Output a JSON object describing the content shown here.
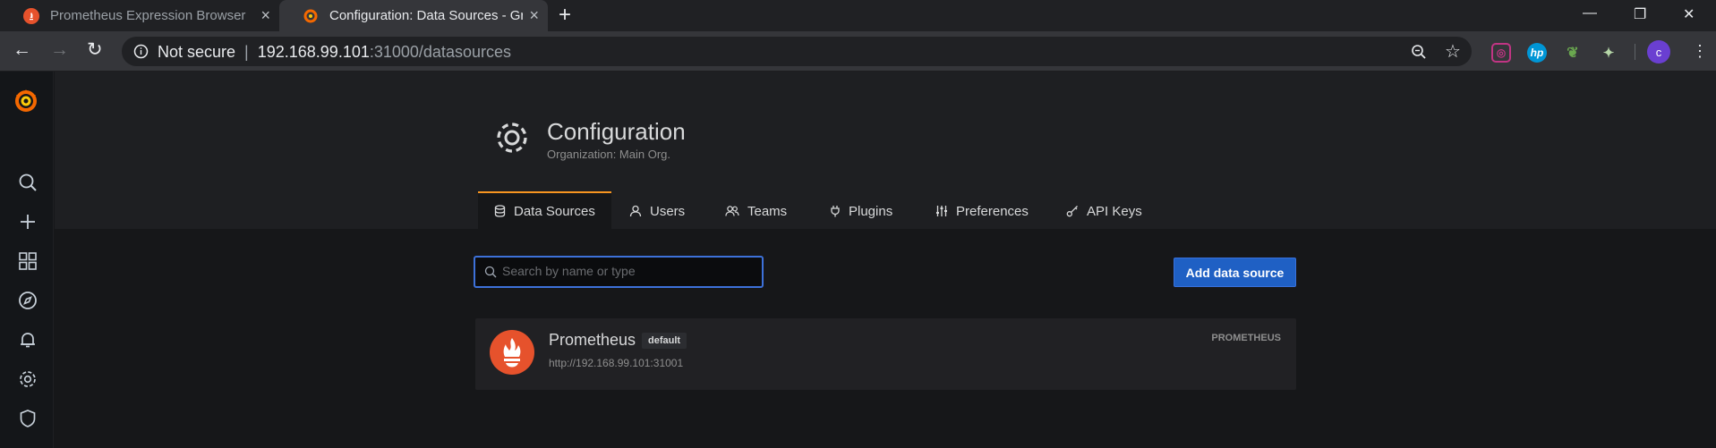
{
  "browser": {
    "tabs": [
      {
        "title": "Prometheus Expression Browser",
        "active": false
      },
      {
        "title": "Configuration: Data Sources - Grafana",
        "active": true
      }
    ],
    "new_tab": "+",
    "security_label": "Not secure",
    "url_host": "192.168.99.101",
    "url_rest": ":31000/datasources",
    "profile_initial": "c",
    "extensions": [
      "instagram-icon",
      "hp-icon",
      "leaf-icon",
      "bug-icon"
    ]
  },
  "sidebar": {
    "items": [
      "grafana-logo",
      "search-icon",
      "plus-icon",
      "dashboards-icon",
      "explore-icon",
      "alerting-icon",
      "configuration-icon",
      "shield-icon"
    ]
  },
  "page": {
    "title": "Configuration",
    "subtitle": "Organization: Main Org.",
    "tabs": [
      {
        "label": "Data Sources",
        "icon": "database-icon",
        "active": true
      },
      {
        "label": "Users",
        "icon": "user-icon",
        "active": false
      },
      {
        "label": "Teams",
        "icon": "users-icon",
        "active": false
      },
      {
        "label": "Plugins",
        "icon": "plug-icon",
        "active": false
      },
      {
        "label": "Preferences",
        "icon": "sliders-icon",
        "active": false
      },
      {
        "label": "API Keys",
        "icon": "key-icon",
        "active": false
      }
    ]
  },
  "search": {
    "placeholder": "Search by name or type",
    "value": ""
  },
  "add_button": "Add data source",
  "datasources": [
    {
      "name": "Prometheus",
      "badge": "default",
      "url": "http://192.168.99.101:31001",
      "type": "PROMETHEUS"
    }
  ],
  "colors": {
    "accent": "#f79520",
    "primary": "#1f60c4",
    "prometheus": "#e6522c",
    "background": "#161719"
  }
}
